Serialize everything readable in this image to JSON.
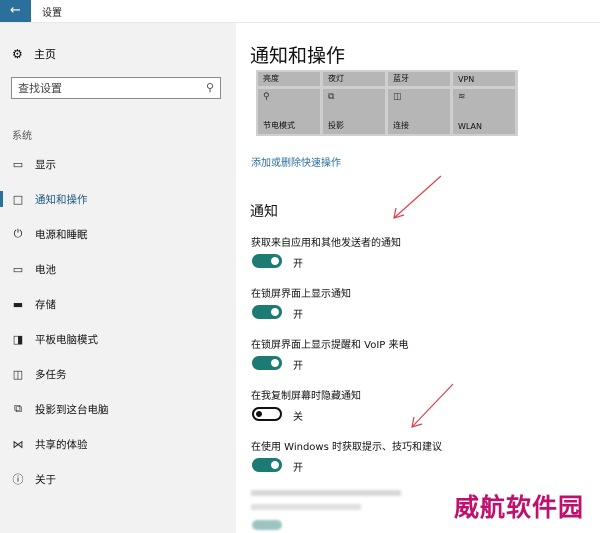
{
  "window": {
    "title": "设置",
    "back_icon": "back-arrow-icon",
    "accent": "#2b6f9b"
  },
  "sidebar": {
    "home_label": "主页",
    "search_placeholder": "查找设置",
    "section_label": "系统",
    "items": [
      {
        "label": "显示",
        "icon": "display-icon"
      },
      {
        "label": "通知和操作",
        "icon": "notification-icon",
        "active": true
      },
      {
        "label": "电源和睡眠",
        "icon": "power-icon"
      },
      {
        "label": "电池",
        "icon": "battery-icon"
      },
      {
        "label": "存储",
        "icon": "storage-icon"
      },
      {
        "label": "平板电脑模式",
        "icon": "tablet-mode-icon"
      },
      {
        "label": "多任务",
        "icon": "multitask-icon"
      },
      {
        "label": "投影到这台电脑",
        "icon": "project-icon"
      },
      {
        "label": "共享的体验",
        "icon": "share-icon"
      },
      {
        "label": "关于",
        "icon": "info-icon"
      }
    ]
  },
  "main": {
    "title": "通知和操作",
    "quick_actions": [
      {
        "label": "亮度"
      },
      {
        "label": "夜灯"
      },
      {
        "label": "蓝牙"
      },
      {
        "label": "VPN"
      },
      {
        "label": "节电模式",
        "icon": "battery-saver-icon"
      },
      {
        "label": "投影",
        "icon": "project-icon"
      },
      {
        "label": "连接",
        "icon": "connect-icon"
      },
      {
        "label": "WLAN",
        "icon": "wlan-icon"
      }
    ],
    "quick_actions_link": "添加或删除快速操作",
    "notifications_title": "通知",
    "settings": [
      {
        "label": "获取来自应用和其他发送者的通知",
        "state": "开",
        "on": true
      },
      {
        "label": "在锁屏界面上显示通知",
        "state": "开",
        "on": true
      },
      {
        "label": "在锁屏界面上显示提醒和 VoIP 来电",
        "state": "开",
        "on": true
      },
      {
        "label": "在我复制屏幕时隐藏通知",
        "state": "关",
        "on": false
      },
      {
        "label": "在使用 Windows 时获取提示、技巧和建议",
        "state": "开",
        "on": true
      }
    ],
    "toggle_on_color": "#1e7b74"
  },
  "watermark": "威航软件园"
}
